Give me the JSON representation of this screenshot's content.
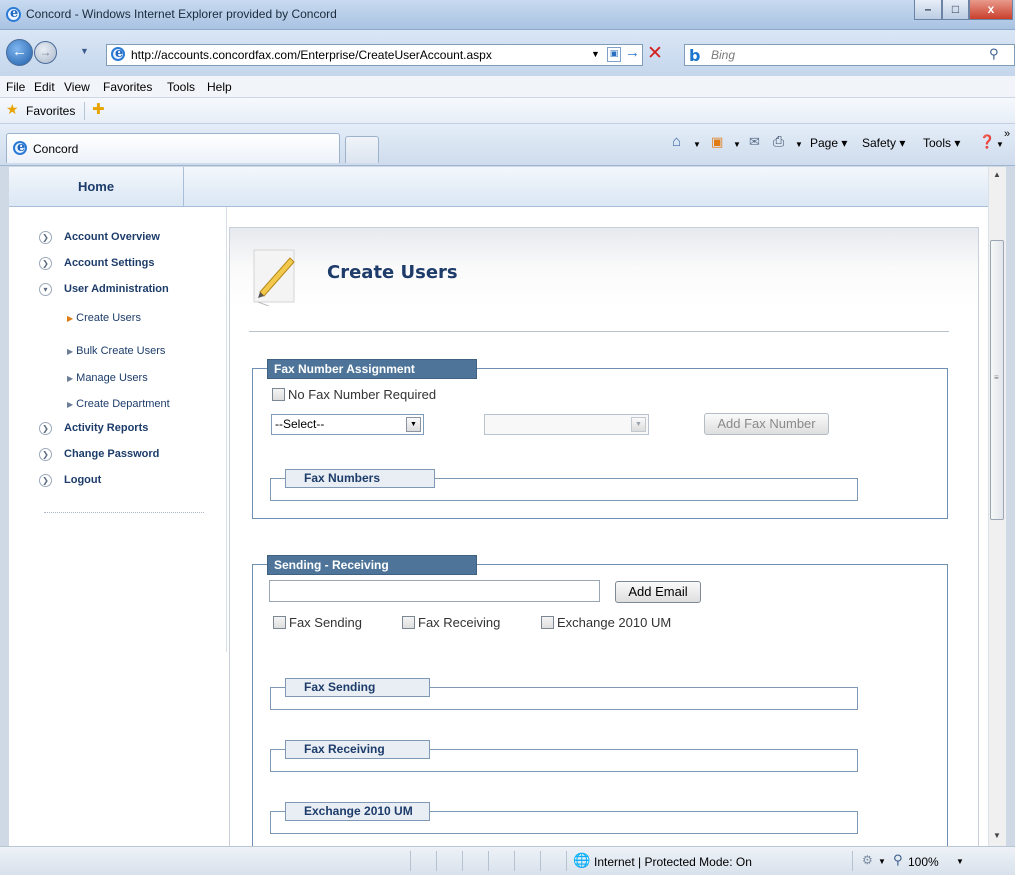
{
  "window": {
    "title": "Concord - Windows Internet Explorer provided by Concord",
    "min": "–",
    "max": "□",
    "close": "x"
  },
  "address": {
    "url": "http://accounts.concordfax.com/Enterprise/CreateUserAccount.aspx"
  },
  "search": {
    "placeholder": "Bing"
  },
  "menu": [
    "File",
    "Edit",
    "View",
    "Favorites",
    "Tools",
    "Help"
  ],
  "favorites": {
    "label": "Favorites"
  },
  "tab": {
    "title": "Concord"
  },
  "commandbar": {
    "page": "Page ▾",
    "safety": "Safety ▾",
    "tools": "Tools ▾",
    "more": "»"
  },
  "nav": {
    "home": "Home",
    "items": [
      "Account Overview",
      "Account Settings",
      "User Administration"
    ],
    "subitems": [
      "Create Users",
      "Bulk Create Users",
      "Manage Users",
      "Create Department"
    ],
    "items2": [
      "Activity Reports",
      "Change Password",
      "Logout"
    ]
  },
  "page": {
    "title": "Create Users"
  },
  "fax_assignment": {
    "legend": "Fax Number Assignment",
    "no_fax": "No Fax Number Required",
    "select": "--Select--",
    "add_btn": "Add Fax Number",
    "fax_numbers": "Fax Numbers"
  },
  "sending": {
    "legend": "Sending - Receiving",
    "add_email": "Add Email",
    "fax_sending": "Fax Sending",
    "fax_receiving": "Fax Receiving",
    "exchange": "Exchange 2010 UM",
    "sub_sending": "Fax Sending",
    "sub_receiving": "Fax Receiving",
    "sub_exchange": "Exchange 2010 UM"
  },
  "status": {
    "zone": "Internet | Protected Mode: On",
    "zoom": "100%"
  },
  "colors": {
    "accent": "#1d3c6a",
    "legend_bg": "#4e7599"
  }
}
